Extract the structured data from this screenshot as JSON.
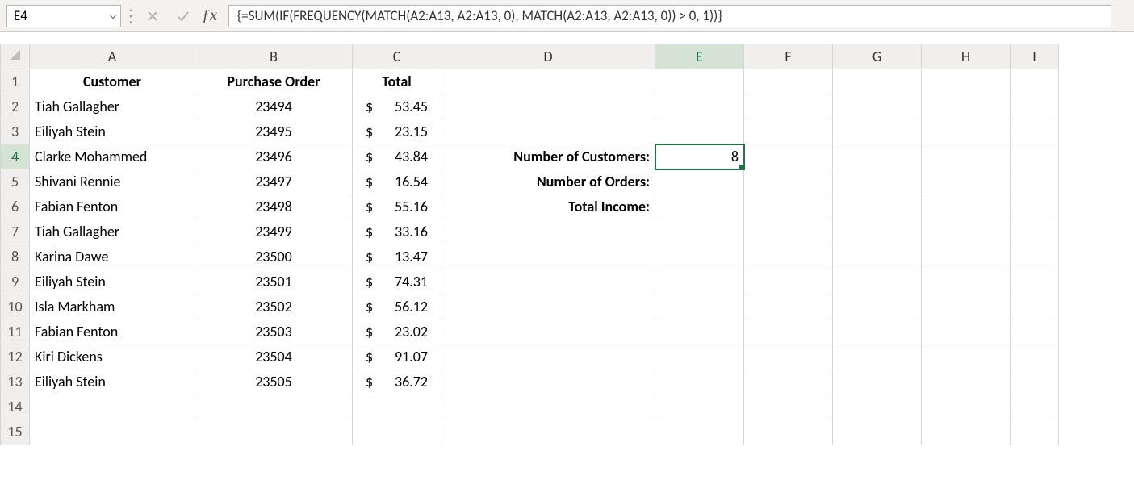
{
  "nameBox": {
    "value": "E4"
  },
  "formulaBar": {
    "formula": "{=SUM(IF(FREQUENCY(MATCH(A2:A13, A2:A13, 0), MATCH(A2:A13, A2:A13, 0)) > 0, 1))}"
  },
  "columns": [
    "A",
    "B",
    "C",
    "D",
    "E",
    "F",
    "G",
    "H",
    "I"
  ],
  "rowHeaders": [
    "1",
    "2",
    "3",
    "4",
    "5",
    "6",
    "7",
    "8",
    "9",
    "10",
    "11",
    "12",
    "13",
    "14",
    "15"
  ],
  "headerRow": {
    "A": "Customer",
    "B": "Purchase Order",
    "C": "Total"
  },
  "dataRows": [
    {
      "customer": "Tiah Gallagher",
      "po": "23494",
      "totalSym": "$",
      "totalVal": "53.45"
    },
    {
      "customer": "Eiliyah Stein",
      "po": "23495",
      "totalSym": "$",
      "totalVal": "23.15"
    },
    {
      "customer": "Clarke Mohammed",
      "po": "23496",
      "totalSym": "$",
      "totalVal": "43.84"
    },
    {
      "customer": "Shivani Rennie",
      "po": "23497",
      "totalSym": "$",
      "totalVal": "16.54"
    },
    {
      "customer": "Fabian Fenton",
      "po": "23498",
      "totalSym": "$",
      "totalVal": "55.16"
    },
    {
      "customer": "Tiah Gallagher",
      "po": "23499",
      "totalSym": "$",
      "totalVal": "33.16"
    },
    {
      "customer": "Karina Dawe",
      "po": "23500",
      "totalSym": "$",
      "totalVal": "13.47"
    },
    {
      "customer": "Eiliyah Stein",
      "po": "23501",
      "totalSym": "$",
      "totalVal": "74.31"
    },
    {
      "customer": "Isla Markham",
      "po": "23502",
      "totalSym": "$",
      "totalVal": "56.12"
    },
    {
      "customer": "Fabian Fenton",
      "po": "23503",
      "totalSym": "$",
      "totalVal": "23.02"
    },
    {
      "customer": "Kiri Dickens",
      "po": "23504",
      "totalSym": "$",
      "totalVal": "91.07"
    },
    {
      "customer": "Eiliyah Stein",
      "po": "23505",
      "totalSym": "$",
      "totalVal": "36.72"
    }
  ],
  "sideLabels": {
    "customers": "Number of Customers:",
    "orders": "Number of Orders:",
    "income": "Total Income:"
  },
  "sideValues": {
    "customersValue": "8"
  },
  "selectedCell": "E4"
}
